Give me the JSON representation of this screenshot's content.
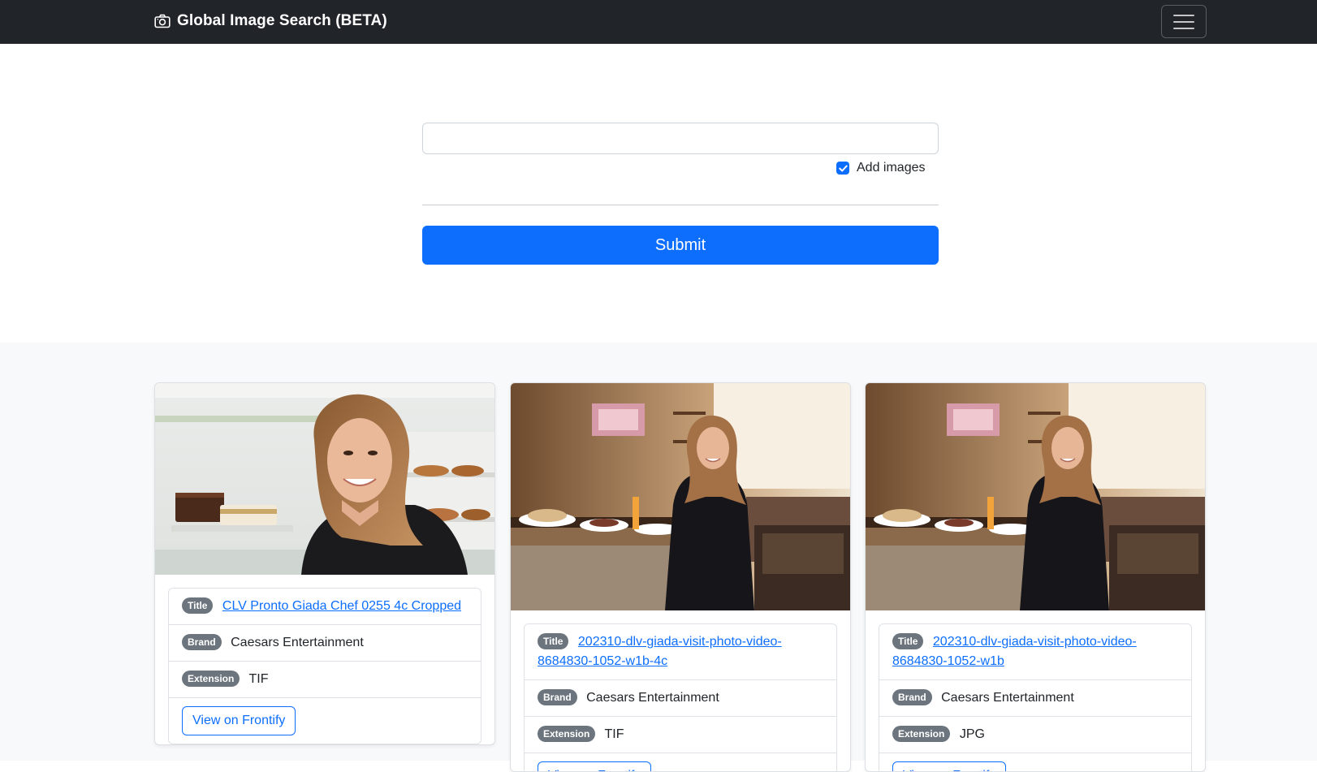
{
  "navbar": {
    "brand_icon": "camera-icon",
    "title": "Global Image Search (BETA)",
    "menu_icon": "hamburger-menu-icon"
  },
  "search": {
    "query_value": "",
    "placeholder": "",
    "add_images_label": "Add images",
    "add_images_checked": true,
    "submit_label": "Submit"
  },
  "colors": {
    "navbar_bg": "#212529",
    "primary": "#0d6efd",
    "badge": "#6c757d",
    "results_bg": "#f8f9fa"
  },
  "results": [
    {
      "image_alt": "Chef in black jacket smiling in a bakery with cakes on display",
      "title_badge": "Title",
      "title": "CLV Pronto Giada Chef 0255 4c Cropped",
      "brand_badge": "Brand",
      "brand": "Caesars Entertainment",
      "extension_badge": "Extension",
      "extension": "TIF",
      "action_label": "View on Frontify"
    },
    {
      "image_alt": "Chef in black jacket standing at a restaurant bar with dishes and a mimosa",
      "title_badge": "Title",
      "title": "202310-dlv-giada-visit-photo-video-8684830-1052-w1b-4c",
      "brand_badge": "Brand",
      "brand": "Caesars Entertainment",
      "extension_badge": "Extension",
      "extension": "TIF",
      "action_label": "View on Frontify"
    },
    {
      "image_alt": "Chef in black jacket standing at a restaurant bar with dishes and a mimosa",
      "title_badge": "Title",
      "title": "202310-dlv-giada-visit-photo-video-8684830-1052-w1b",
      "brand_badge": "Brand",
      "brand": "Caesars Entertainment",
      "extension_badge": "Extension",
      "extension": "JPG",
      "action_label": "View on Frontify"
    }
  ]
}
